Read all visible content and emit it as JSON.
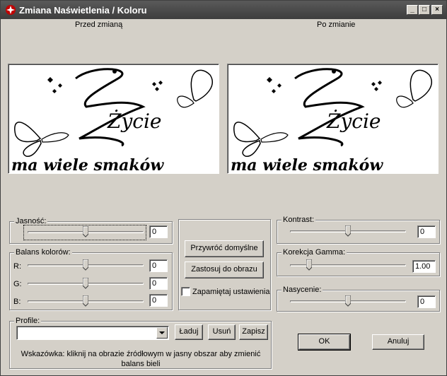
{
  "window": {
    "title": "Zmiana Naświetlenia / Koloru",
    "minimize_glyph": "_",
    "maximize_glyph": "□",
    "close_glyph": "×"
  },
  "preview": {
    "before_label": "Przed zmianą",
    "after_label": "Po zmianie",
    "image_text_line1": "Życie",
    "image_text_line2": "ma wiele smaków"
  },
  "brightness": {
    "title": "Jasność:",
    "value": "0",
    "level": 0.5
  },
  "color_balance": {
    "title": "Balans kolorów:",
    "channels": [
      {
        "label": "R:",
        "value": "0",
        "level": 0.5
      },
      {
        "label": "G:",
        "value": "0",
        "level": 0.5
      },
      {
        "label": "B:",
        "value": "0",
        "level": 0.5
      }
    ]
  },
  "actions": {
    "restore_defaults": "Przywróć domyślne",
    "apply_to_image": "Zastosuj do obrazu",
    "remember_settings": "Zapamiętaj ustawienia",
    "remember_checked": false
  },
  "contrast": {
    "title": "Kontrast:",
    "value": "0",
    "level": 0.5
  },
  "gamma": {
    "title": "Korekcja Gamma:",
    "value": "1.00",
    "level": 0.15
  },
  "saturation": {
    "title": "Nasycenie:",
    "value": "0",
    "level": 0.5
  },
  "profile": {
    "title": "Profile:",
    "selected": "",
    "load": "Ładuj",
    "delete": "Usuń",
    "save": "Zapisz"
  },
  "hint": {
    "line1": "Wskazówka: kliknij na obrazie źródłowym w jasny obszar aby zmienić",
    "line2": "balans bieli"
  },
  "dialog": {
    "ok": "OK",
    "cancel": "Anuluj"
  }
}
